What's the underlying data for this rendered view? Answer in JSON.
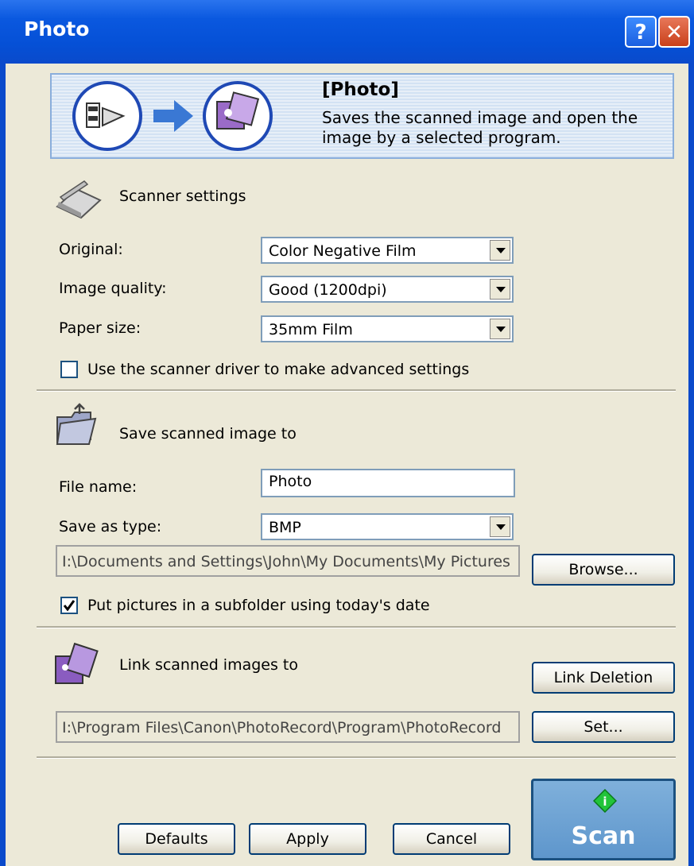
{
  "window": {
    "title": "Photo",
    "help_label": "?",
    "close_label": "✕"
  },
  "banner": {
    "title": "[Photo]",
    "description": "Saves the scanned image and open the image by a selected program."
  },
  "scanner_settings": {
    "header": "Scanner settings",
    "original_label": "Original:",
    "original_value": "Color Negative Film",
    "quality_label": "Image quality:",
    "quality_value": "Good (1200dpi)",
    "paper_label": "Paper size:",
    "paper_value": "35mm Film",
    "advanced_label": "Use the scanner driver to make advanced settings",
    "advanced_checked": false
  },
  "save_section": {
    "header": "Save scanned image to",
    "filename_label": "File name:",
    "filename_value": "Photo",
    "type_label": "Save as type:",
    "type_value": "BMP",
    "folder_path": "I:\\Documents and Settings\\John\\My Documents\\My Pictures",
    "browse_label": "Browse...",
    "subfolder_label": "Put pictures in a subfolder using today's date",
    "subfolder_checked": true
  },
  "link_section": {
    "header": "Link scanned images to",
    "link_deletion_label": "Link Deletion",
    "program_path": "I:\\Program Files\\Canon\\PhotoRecord\\Program\\PhotoRecord",
    "set_label": "Set..."
  },
  "footer": {
    "defaults_label": "Defaults",
    "apply_label": "Apply",
    "cancel_label": "Cancel",
    "scan_label": "Scan"
  },
  "colors": {
    "titlebar": "#0a58df",
    "dialog_bg": "#ece9d8",
    "scan_button": "#6aa0d3",
    "annotation_line": "#e00000"
  }
}
